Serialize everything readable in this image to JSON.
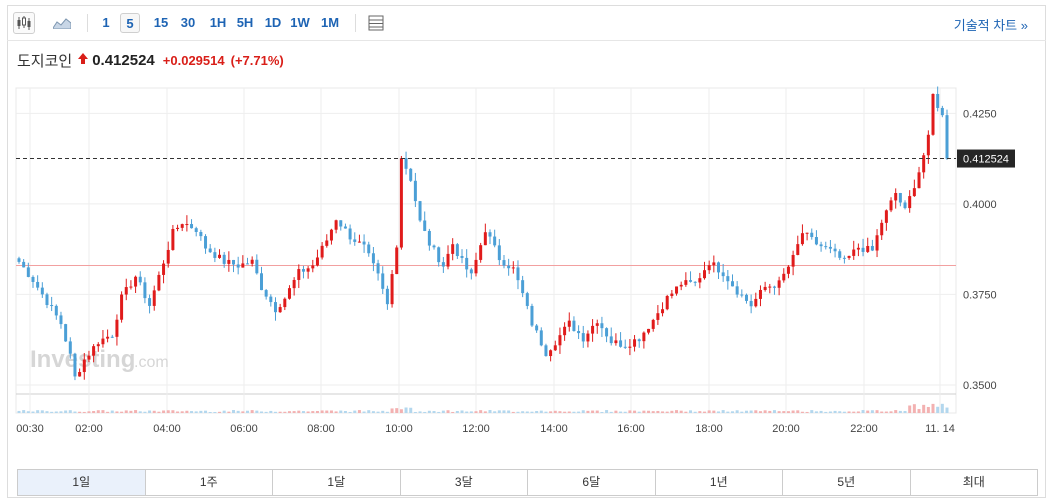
{
  "toolbar": {
    "icons": [
      "candlestick-icon",
      "area-chart-icon",
      "table-icon"
    ],
    "timeframes": [
      "1",
      "5",
      "15",
      "30",
      "1H",
      "5H",
      "1D",
      "1W",
      "1M"
    ],
    "active_timeframe": "5",
    "technical_link": "기술적 차트 »"
  },
  "quote": {
    "name": "도지코인",
    "price": "0.412524",
    "change": "+0.029514",
    "change_pct": "(+7.71%)",
    "direction": "up"
  },
  "watermark": {
    "brand": "Investing",
    "suffix": ".com"
  },
  "colors": {
    "up": "#e01b1b",
    "down": "#4b9fd6",
    "change": "#d91e18",
    "link": "#1e64b4",
    "ref_line": "#f2a0a0",
    "price_tag_bg": "#262626"
  },
  "ranges": [
    "1일",
    "1주",
    "1달",
    "3달",
    "6달",
    "1년",
    "5년",
    "최대"
  ],
  "active_range": "1일",
  "chart_data": {
    "type": "candlestick",
    "x_tick_labels": [
      "00:30",
      "02:00",
      "04:00",
      "06:00",
      "08:00",
      "10:00",
      "12:00",
      "14:00",
      "16:00",
      "18:00",
      "20:00",
      "22:00",
      "11. 14"
    ],
    "y_tick_labels": [
      "0.4250",
      "0.4000",
      "0.3750",
      "0.3500"
    ],
    "ylim": [
      0.3475,
      0.432
    ],
    "current_price": 0.412524,
    "current_price_label": "0.412524",
    "previous_close": 0.383,
    "close_path": [
      [
        0,
        0.384
      ],
      [
        3,
        0.379
      ],
      [
        6,
        0.373
      ],
      [
        9,
        0.367
      ],
      [
        11,
        0.358
      ],
      [
        12,
        0.352
      ],
      [
        14,
        0.357
      ],
      [
        17,
        0.362
      ],
      [
        20,
        0.364
      ],
      [
        22,
        0.374
      ],
      [
        25,
        0.38
      ],
      [
        28,
        0.372
      ],
      [
        31,
        0.384
      ],
      [
        33,
        0.392
      ],
      [
        35,
        0.395
      ],
      [
        38,
        0.393
      ],
      [
        40,
        0.388
      ],
      [
        44,
        0.384
      ],
      [
        47,
        0.383
      ],
      [
        50,
        0.384
      ],
      [
        52,
        0.377
      ],
      [
        55,
        0.371
      ],
      [
        57,
        0.374
      ],
      [
        60,
        0.381
      ],
      [
        63,
        0.383
      ],
      [
        66,
        0.39
      ],
      [
        68,
        0.396
      ],
      [
        71,
        0.391
      ],
      [
        74,
        0.388
      ],
      [
        77,
        0.38
      ],
      [
        79,
        0.372
      ],
      [
        81,
        0.389
      ],
      [
        82,
        0.413
      ],
      [
        84,
        0.407
      ],
      [
        86,
        0.395
      ],
      [
        88,
        0.389
      ],
      [
        91,
        0.383
      ],
      [
        93,
        0.389
      ],
      [
        95,
        0.384
      ],
      [
        97,
        0.38
      ],
      [
        100,
        0.393
      ],
      [
        103,
        0.385
      ],
      [
        106,
        0.382
      ],
      [
        108,
        0.375
      ],
      [
        110,
        0.367
      ],
      [
        113,
        0.359
      ],
      [
        115,
        0.362
      ],
      [
        118,
        0.367
      ],
      [
        121,
        0.363
      ],
      [
        124,
        0.368
      ],
      [
        127,
        0.362
      ],
      [
        130,
        0.361
      ],
      [
        133,
        0.363
      ],
      [
        136,
        0.368
      ],
      [
        139,
        0.374
      ],
      [
        142,
        0.378
      ],
      [
        145,
        0.378
      ],
      [
        148,
        0.384
      ],
      [
        151,
        0.381
      ],
      [
        154,
        0.376
      ],
      [
        157,
        0.372
      ],
      [
        160,
        0.377
      ],
      [
        163,
        0.378
      ],
      [
        166,
        0.385
      ],
      [
        168,
        0.392
      ],
      [
        171,
        0.389
      ],
      [
        174,
        0.387
      ],
      [
        177,
        0.384
      ],
      [
        180,
        0.388
      ],
      [
        183,
        0.387
      ],
      [
        185,
        0.395
      ],
      [
        188,
        0.403
      ],
      [
        190,
        0.398
      ],
      [
        193,
        0.409
      ],
      [
        195,
        0.418
      ],
      [
        196,
        0.43
      ],
      [
        198,
        0.4245
      ],
      [
        199,
        0.4125
      ]
    ],
    "volume": {
      "type": "bar",
      "ylim": [
        0,
        1
      ]
    }
  }
}
